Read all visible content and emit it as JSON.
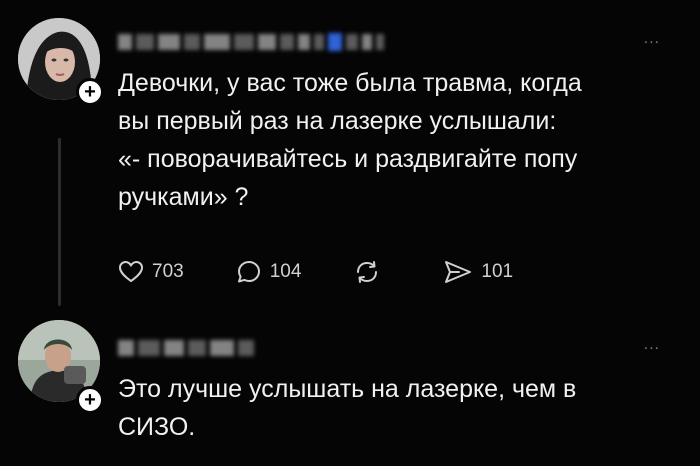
{
  "post1": {
    "text": "Девочки, у вас тоже была травма, когда\nвы первый раз на лазерке услышали:\n«- поворачивайтесь и раздвигайте попу\nручками» ?",
    "more_label": "...",
    "actions": {
      "like_count": "703",
      "reply_count": "104",
      "repost_icon": "repost-icon",
      "share_count": "101"
    }
  },
  "post2": {
    "text": "Это лучше услышать на лазерке, чем в\nСИЗО.",
    "more_label": "..."
  },
  "colors": {
    "background": "#050505",
    "text": "#f1f1f1",
    "muted": "#7a7a7a",
    "verified_blue": "#2f63d6"
  }
}
